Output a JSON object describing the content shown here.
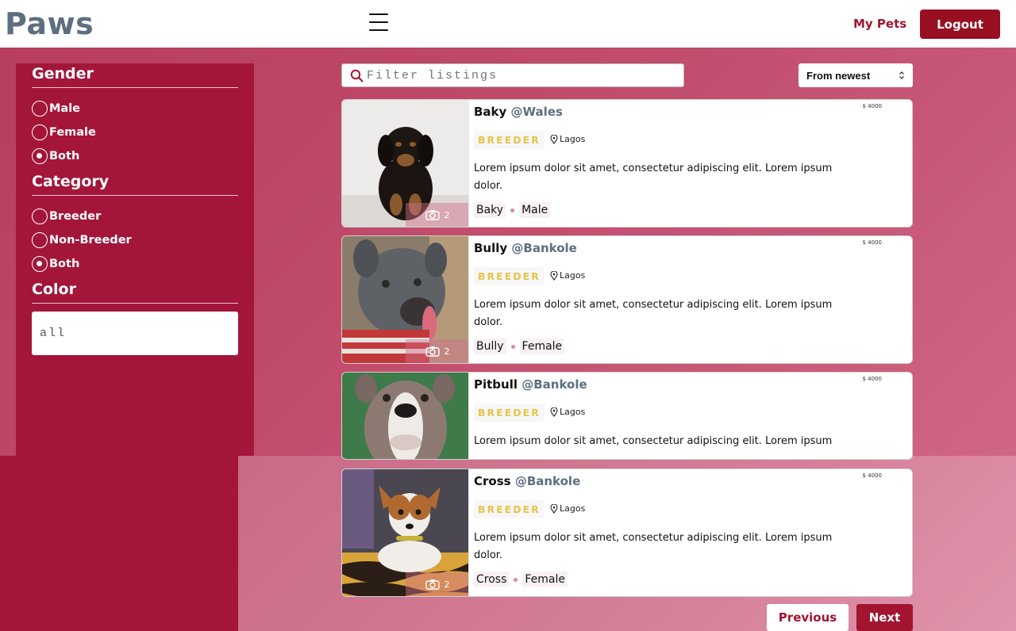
{
  "header": {
    "logo": "Paws",
    "my_pets_label": "My Pets",
    "logout_label": "Logout"
  },
  "sidebar": {
    "gender": {
      "heading": "Gender",
      "options": [
        "Male",
        "Female",
        "Both"
      ],
      "selected": "Both"
    },
    "category": {
      "heading": "Category",
      "options": [
        "Breeder",
        "Non-Breeder",
        "Both"
      ],
      "selected": "Both"
    },
    "color": {
      "heading": "Color",
      "value": "all"
    }
  },
  "search": {
    "placeholder": "Filter listings"
  },
  "sort": {
    "selected": "From newest"
  },
  "listings": [
    {
      "name": "Baky",
      "handle": "@Wales",
      "price": "$ 4000",
      "badge": "BREEDER",
      "location": "Lagos",
      "description": "Lorem ipsum dolor sit amet, consectetur adipiscing elit. Lorem ipsum dolor.",
      "tag_name": "Baky",
      "gender": "Male",
      "photo_count": "2"
    },
    {
      "name": "Bully",
      "handle": "@Bankole",
      "price": "$ 4000",
      "badge": "BREEDER",
      "location": "Lagos",
      "description": "Lorem ipsum dolor sit amet, consectetur adipiscing elit. Lorem ipsum dolor.",
      "tag_name": "Bully",
      "gender": "Female",
      "photo_count": "2"
    },
    {
      "name": "Pitbull",
      "handle": "@Bankole",
      "price": "$ 4000",
      "badge": "BREEDER",
      "location": "Lagos",
      "description": "Lorem ipsum dolor sit amet, consectetur adipiscing elit. Lorem ipsum"
    },
    {
      "name": "Cross",
      "handle": "@Bankole",
      "price": "$ 4000",
      "badge": "BREEDER",
      "location": "Lagos",
      "description": "Lorem ipsum dolor sit amet, consectetur adipiscing elit. Lorem ipsum dolor.",
      "tag_name": "Cross",
      "gender": "Female",
      "photo_count": "2"
    }
  ],
  "pagination": {
    "previous_label": "Previous",
    "next_label": "Next"
  },
  "colors": {
    "accent": "#a31431",
    "logout": "#980f22",
    "sidebar": "#a3163a",
    "badge": "#e6c44a"
  }
}
